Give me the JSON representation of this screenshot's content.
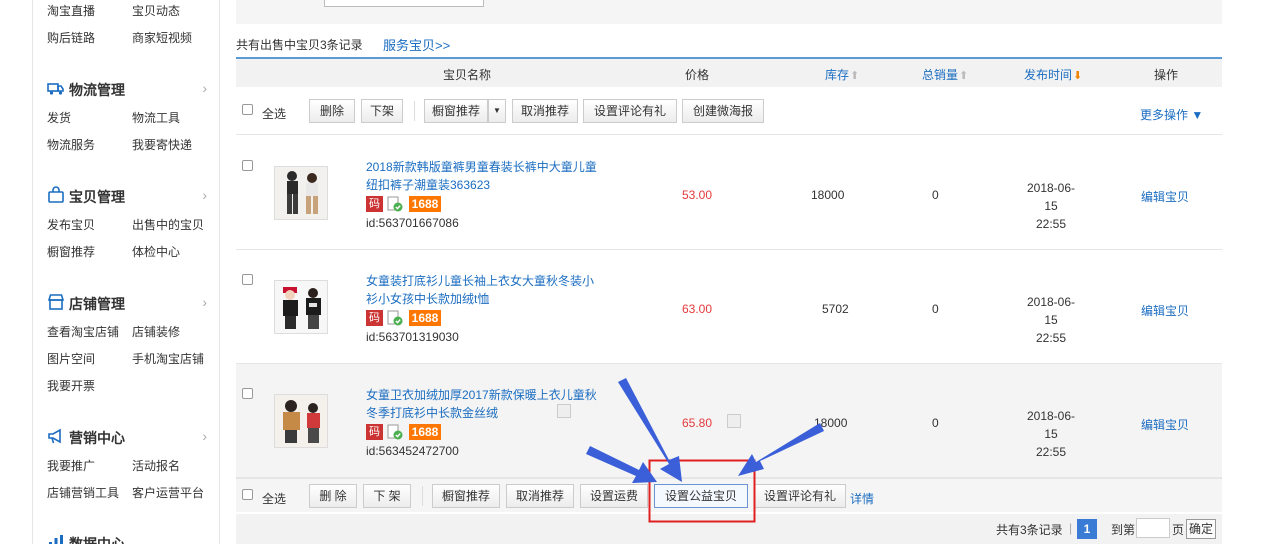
{
  "sidebar": {
    "top_items": [
      [
        "淘宝直播",
        "宝贝动态"
      ],
      [
        "购后链路",
        "商家短视频"
      ]
    ],
    "sections": [
      {
        "title": "物流管理",
        "icon": "truck-icon",
        "items": [
          [
            "发货",
            "物流工具"
          ],
          [
            "物流服务",
            "我要寄快递"
          ]
        ]
      },
      {
        "title": "宝贝管理",
        "icon": "bag-icon",
        "items": [
          [
            "发布宝贝",
            "出售中的宝贝"
          ],
          [
            "橱窗推荐",
            "体检中心"
          ]
        ]
      },
      {
        "title": "店铺管理",
        "icon": "store-icon",
        "items": [
          [
            "查看淘宝店铺",
            "店铺装修"
          ],
          [
            "图片空间",
            "手机淘宝店铺"
          ],
          [
            "我要开票",
            ""
          ]
        ]
      },
      {
        "title": "营销中心",
        "icon": "megaphone-icon",
        "items": [
          [
            "我要推广",
            "活动报名"
          ],
          [
            "店铺营销工具",
            "客户运营平台"
          ]
        ]
      },
      {
        "title": "数据中心",
        "icon": "chart-icon",
        "items": []
      }
    ],
    "chevron": "›"
  },
  "summary": "共有出售中宝贝3条记录",
  "service_link": "服务宝贝>>",
  "table": {
    "headers": {
      "name": "宝贝名称",
      "price": "价格",
      "stock": "库存",
      "sales": "总销量",
      "publish": "发布时间",
      "ops": "操作"
    },
    "sort_arrows": {
      "stock": "⬆",
      "sales": "⬆",
      "publish": "⬇"
    },
    "toolbar": {
      "select_all": "全选",
      "delete": "删除",
      "unlist": "下架",
      "showcase": "橱窗推荐",
      "dropdown_caret": "▼",
      "cancel_recommend": "取消推荐",
      "set_review_gift": "设置评论有礼",
      "create_poster": "创建微海报",
      "more_ops": "更多操作 ▼"
    },
    "rows": [
      {
        "title": "2018新款韩版童裤男童春装长裤中大童儿童纽扣裤子潮童装363623",
        "badge_ma": "码",
        "badge_1688": "1688",
        "id": "id:563701667086",
        "price": "53.00",
        "stock": "18000",
        "sales": "0",
        "date": "2018-06-15",
        "time": "22:55",
        "edit": "编辑宝贝"
      },
      {
        "title": "女童装打底衫儿童长袖上衣女大童秋冬装小衫小女孩中长款加绒t恤",
        "badge_ma": "码",
        "badge_1688": "1688",
        "id": "id:563701319030",
        "price": "63.00",
        "stock": "5702",
        "sales": "0",
        "date": "2018-06-15",
        "time": "22:55",
        "edit": "编辑宝贝"
      },
      {
        "title": "女童卫衣加绒加厚2017新款保暖上衣儿童秋冬季打底衫中长款金丝绒",
        "badge_ma": "码",
        "badge_1688": "1688",
        "id": "id:563452472700",
        "price": "65.80",
        "stock": "18000",
        "sales": "0",
        "date": "2018-06-15",
        "time": "22:55",
        "edit": "编辑宝贝"
      }
    ],
    "bottom": {
      "select_all": "全选",
      "delete": "删 除",
      "unlist": "下 架",
      "showcase": "橱窗推荐",
      "cancel_recommend": "取消推荐",
      "set_shipping": "设置运费",
      "set_charity": "设置公益宝贝",
      "set_review_gift": "设置评论有礼",
      "details": "详情"
    },
    "pager": {
      "total": "共有3条记录",
      "divider": "|",
      "current": "1",
      "goto": "到第",
      "page_unit": "页",
      "confirm": "确定"
    }
  },
  "colors": {
    "link": "#1b6dc1",
    "price": "#e4393c",
    "accent_blue": "#3a5fd9",
    "highlight_red": "#e02020",
    "badge_orange": "#ff7700"
  }
}
